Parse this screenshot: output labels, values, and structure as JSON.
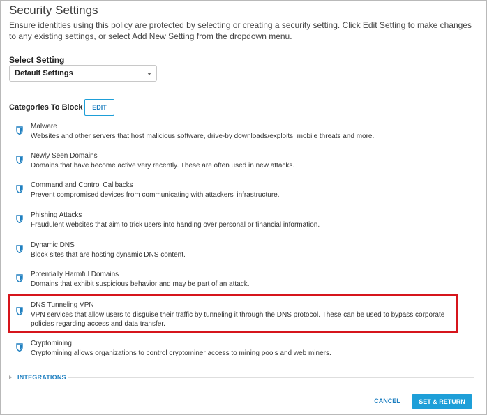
{
  "page": {
    "title": "Security Settings",
    "description": "Ensure identities using this policy are protected by selecting or creating a security setting. Click Edit Setting to make changes to any existing settings, or select Add New Setting from the dropdown menu."
  },
  "select_setting": {
    "label": "Select Setting",
    "value": "Default Settings"
  },
  "categories_section": {
    "heading": "Categories To Block",
    "edit_label": "EDIT"
  },
  "categories": [
    {
      "icon": "shield-icon",
      "title": "Malware",
      "description": "Websites and other servers that host malicious software, drive-by downloads/exploits, mobile threats and more."
    },
    {
      "icon": "shield-icon",
      "title": "Newly Seen Domains",
      "description": "Domains that have become active very recently. These are often used in new attacks."
    },
    {
      "icon": "shield-icon",
      "title": "Command and Control Callbacks",
      "description": "Prevent compromised devices from communicating with attackers' infrastructure."
    },
    {
      "icon": "shield-icon",
      "title": "Phishing Attacks",
      "description": "Fraudulent websites that aim to trick users into handing over personal or financial information."
    },
    {
      "icon": "shield-icon",
      "title": "Dynamic DNS",
      "description": "Block sites that are hosting dynamic DNS content."
    },
    {
      "icon": "shield-icon",
      "title": "Potentially Harmful Domains",
      "description": "Domains that exhibit suspicious behavior and may be part of an attack."
    },
    {
      "icon": "shield-icon",
      "title": "DNS Tunneling VPN",
      "description": "VPN services that allow users to disguise their traffic by tunneling it through the DNS protocol. These can be used to bypass corporate policies regarding access and data transfer."
    },
    {
      "icon": "shield-icon",
      "title": "Cryptomining",
      "description": "Cryptomining allows organizations to control cryptominer access to mining pools and web miners."
    }
  ],
  "integrations": {
    "label": "INTEGRATIONS"
  },
  "footer": {
    "cancel_label": "CANCEL",
    "set_return_label": "SET & RETURN"
  },
  "colors": {
    "accent": "#1e9fd8",
    "highlight": "#d6151c",
    "shield": "#1e7fc0"
  }
}
